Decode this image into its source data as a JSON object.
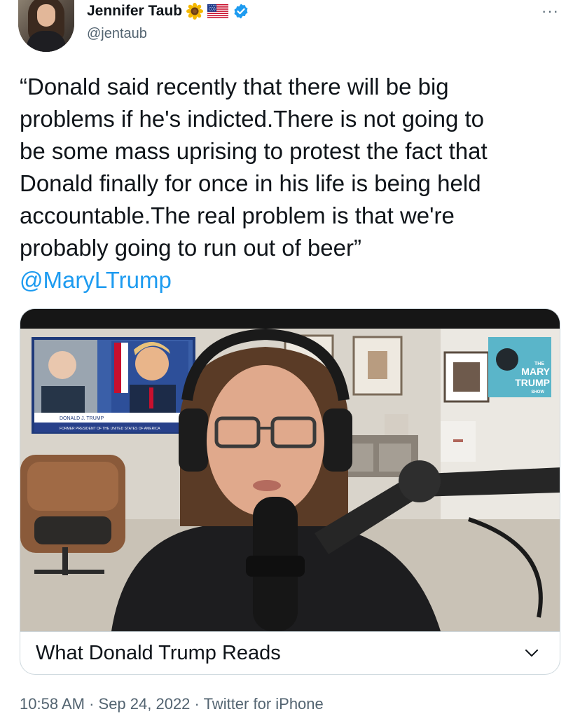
{
  "author": {
    "name": "Jennifer Taub",
    "handle": "@jentaub"
  },
  "icons": {
    "sunflower": "sunflower-emoji",
    "flag": "us-flag-emoji",
    "verified": "verified-badge",
    "more": "more-dots"
  },
  "more_label": "···",
  "tweet": {
    "lines": [
      "“Donald said recently that there will be big",
      "problems if he's indicted.There is not going to",
      "be some mass uprising to protest the fact that",
      "Donald finally for once in his life is being held",
      "accountable.The real problem is that we're",
      "probably going to run out of beer”"
    ],
    "mention": "@MaryLTrump"
  },
  "video": {
    "inset_caption": "DONALD J. TRUMP",
    "inset_subcaption": "FORMER PRESIDENT OF THE UNITED STATES OF AMERICA",
    "logo_the": "THE",
    "logo_mary": "MARY",
    "logo_trump": "TRUMP",
    "logo_show": "SHOW"
  },
  "card": {
    "title": "What Donald Trump Reads"
  },
  "meta": {
    "time": "10:58 AM",
    "sep1": " · ",
    "date": "Sep 24, 2022",
    "sep2": " · ",
    "source": "Twitter for iPhone"
  },
  "colors": {
    "link": "#1d9bf0",
    "secondary_text": "#536471",
    "border": "#cfd9de"
  }
}
